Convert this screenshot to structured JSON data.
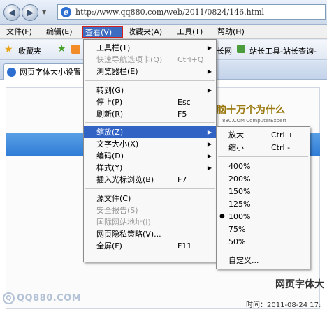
{
  "address_bar": {
    "back_glyph": "◀",
    "forward_glyph": "▶",
    "dropdown_glyph": "▼",
    "url": "http://www.qq880.com/web/2011/0824/146.html"
  },
  "menu_bar": {
    "file": "文件(F)",
    "edit": "编辑(E)",
    "view": "查看(V)",
    "favorites": "收藏夹(A)",
    "tools": "工具(T)",
    "help": "帮助(H)"
  },
  "favorites_bar": {
    "label": "收藏夹",
    "link1": "长网",
    "link2": "站长工具-站长查询-"
  },
  "tab": {
    "title": "网页字体大小设置"
  },
  "page": {
    "slogan": "脑十万个为什么",
    "slogan_sub": "880.COM  ComputerExpert",
    "article_title": "网页字体大",
    "article_time": "时间：2011-08-24 17:",
    "watermark": "QQ880.COM",
    "watermark_glyph": "Q"
  },
  "view_menu": {
    "items": [
      {
        "label": "工具栏(T)",
        "key": "",
        "submenu": true,
        "disabled": false
      },
      {
        "label": "快速导航选项卡(Q)",
        "key": "Ctrl+Q",
        "submenu": false,
        "disabled": true
      },
      {
        "label": "浏览器栏(E)",
        "key": "",
        "submenu": true,
        "disabled": false
      },
      {
        "label": "转到(G)",
        "key": "",
        "submenu": true,
        "disabled": false
      },
      {
        "label": "停止(P)",
        "key": "Esc",
        "submenu": false,
        "disabled": false
      },
      {
        "label": "刷新(R)",
        "key": "F5",
        "submenu": false,
        "disabled": false
      },
      {
        "label": "缩放(Z)",
        "key": "",
        "submenu": true,
        "disabled": false
      },
      {
        "label": "文字大小(X)",
        "key": "",
        "submenu": true,
        "disabled": false
      },
      {
        "label": "编码(D)",
        "key": "",
        "submenu": true,
        "disabled": false
      },
      {
        "label": "样式(Y)",
        "key": "",
        "submenu": true,
        "disabled": false
      },
      {
        "label": "插入光标浏览(B)",
        "key": "F7",
        "submenu": false,
        "disabled": false
      },
      {
        "label": "源文件(C)",
        "key": "",
        "submenu": false,
        "disabled": false
      },
      {
        "label": "安全报告(S)",
        "key": "",
        "submenu": false,
        "disabled": true
      },
      {
        "label": "国际网站地址(I)",
        "key": "",
        "submenu": false,
        "disabled": true
      },
      {
        "label": "网页隐私策略(V)...",
        "key": "",
        "submenu": false,
        "disabled": false
      },
      {
        "label": "全屏(F)",
        "key": "F11",
        "submenu": false,
        "disabled": false
      }
    ],
    "highlighted_item": "缩放(Z)"
  },
  "zoom_menu": {
    "items": [
      {
        "label": "放大",
        "key": "Ctrl +"
      },
      {
        "label": "缩小",
        "key": "Ctrl -"
      },
      {
        "label": "400%",
        "key": ""
      },
      {
        "label": "200%",
        "key": ""
      },
      {
        "label": "150%",
        "key": ""
      },
      {
        "label": "125%",
        "key": ""
      },
      {
        "label": "100%",
        "key": ""
      },
      {
        "label": "75%",
        "key": ""
      },
      {
        "label": "50%",
        "key": ""
      },
      {
        "label": "自定义...",
        "key": ""
      }
    ],
    "selected": "100%",
    "bullet_glyph": "●"
  },
  "colors": {
    "menu_highlight": "#3163c5",
    "view_menu_outline": "#d02020",
    "blue_band": "#2f7cd6"
  }
}
